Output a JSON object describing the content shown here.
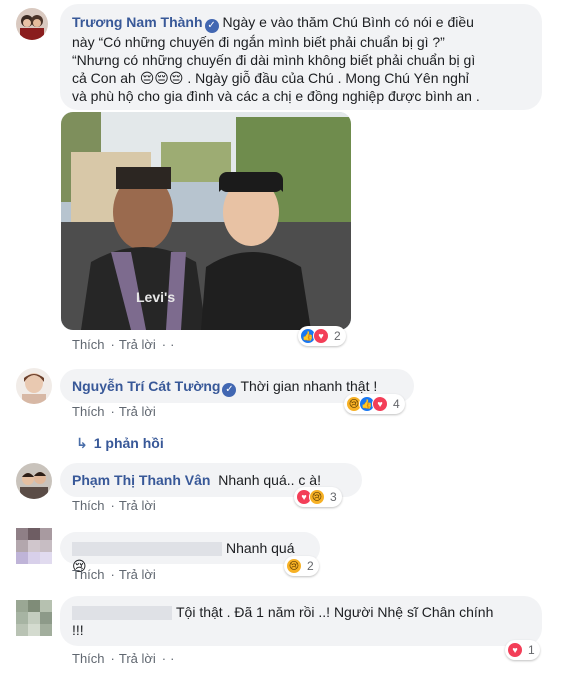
{
  "comments": [
    {
      "author": "Trương Nam Thành",
      "verified": true,
      "text_line1": "Ngày e vào thăm Chú Bình có nói e điều",
      "text_line2": "này “Có những chuyến đi ngắn mình biết phải chuẩn bị gì ?”",
      "text_line3": "“Nhưng có những chuyến đi dài mình không biết phải chuẩn bị gì",
      "text_line4": "cả Con ah 😔😔😔 . Ngày giỗ đầu của Chú . Mong Chú Yên nghỉ",
      "text_line5": "và phù hộ cho gia đình và các a chị e đồng nghiệp được bình an .",
      "like_label": "Thích",
      "reply_label": "Trả lời",
      "reaction_count": "2"
    },
    {
      "author": "Nguyễn Trí Cát Tường",
      "verified": true,
      "text": "Thời gian nhanh thật !",
      "like_label": "Thích",
      "reply_label": "Trả lời",
      "reaction_count": "4",
      "replies_link": "1 phản hồi"
    },
    {
      "author": "Phạm Thị Thanh Vân",
      "text": "Nhanh quá.. c à!",
      "like_label": "Thích",
      "reply_label": "Trả lời",
      "reaction_count": "3"
    },
    {
      "text": "Nhanh quá😢",
      "like_label": "Thích",
      "reply_label": "Trả lời",
      "reaction_count": "2"
    },
    {
      "text_line1": "Tội thật . Đã 1 năm rồi ..! Người Nhệ sĩ Chân chính",
      "text_line2": "!!!",
      "like_label": "Thích",
      "reply_label": "Trả lời",
      "reaction_count": "1"
    }
  ],
  "colors": {
    "link": "#385898",
    "bubble": "#f2f3f5",
    "meta": "#606770"
  }
}
